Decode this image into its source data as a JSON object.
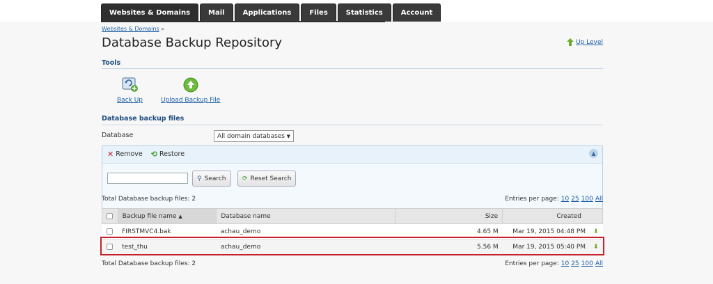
{
  "nav": {
    "tabs": [
      "Websites & Domains",
      "Mail",
      "Applications",
      "Files",
      "Statistics",
      "Account"
    ]
  },
  "breadcrumb": {
    "link": "Websites & Domains",
    "sep": "»"
  },
  "page": {
    "title": "Database Backup Repository",
    "up_level": "Up Level"
  },
  "tools": {
    "title": "Tools",
    "back_up": "Back Up",
    "upload": "Upload Backup File"
  },
  "files_section": {
    "title": "Database backup files"
  },
  "filter": {
    "label": "Database",
    "selected": "All domain databases"
  },
  "panel": {
    "remove": "Remove",
    "restore": "Restore",
    "search_value": "",
    "search_btn": "Search",
    "reset_btn": "Reset Search"
  },
  "totals": {
    "text": "Total Database backup files: 2"
  },
  "entries": {
    "label": "Entries per page:",
    "options": [
      "10",
      "25",
      "100",
      "All"
    ]
  },
  "table": {
    "headers": {
      "name": "Backup file name",
      "db": "Database name",
      "size": "Size",
      "created": "Created"
    },
    "rows": [
      {
        "name": "FIRSTMVC4.bak",
        "db": "achau_demo",
        "size": "4.65 M",
        "created": "Mar 19, 2015 04:48 PM"
      },
      {
        "name": "test_thu",
        "db": "achau_demo",
        "size": "5.56 M",
        "created": "Mar 19, 2015 05:40 PM"
      }
    ]
  },
  "colors": {
    "accent": "#1d5fa6",
    "highlight": "#c8202a",
    "nav_bg": "#2f2f2f"
  }
}
